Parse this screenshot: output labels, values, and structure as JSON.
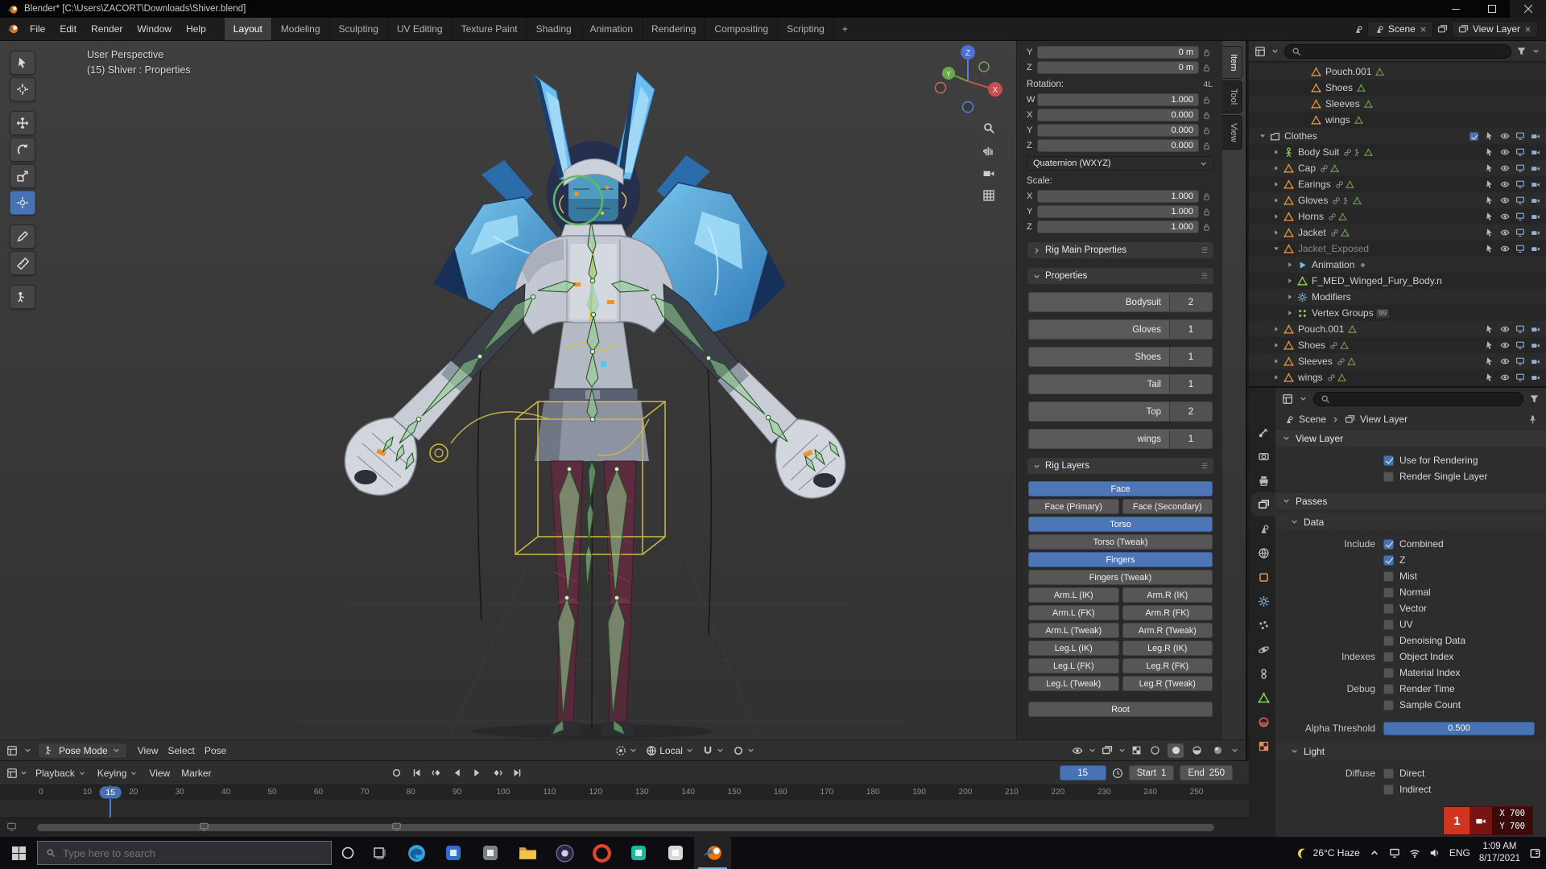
{
  "window": {
    "title": "Blender* [C:\\Users\\ZACORT\\Downloads\\Shiver.blend]"
  },
  "topbar": {
    "app_menus": [
      "File",
      "Edit",
      "Render",
      "Window",
      "Help"
    ],
    "workspaces": [
      "Layout",
      "Modeling",
      "Sculpting",
      "UV Editing",
      "Texture Paint",
      "Shading",
      "Animation",
      "Rendering",
      "Compositing",
      "Scripting"
    ],
    "active_workspace": "Layout",
    "new_workspace": "+",
    "scene": "Scene",
    "view_layer": "View Layer"
  },
  "viewport": {
    "overlay": {
      "perspective": "User Perspective",
      "context": "(15) Shiver : Properties"
    },
    "axis_labels": {
      "x": "X",
      "y": "Y",
      "z": "Z"
    },
    "tools": [
      "tweak-select",
      "cursor-3d",
      "move",
      "rotate",
      "scale",
      "transform",
      "annotate",
      "measure",
      "pose-extra"
    ],
    "active_tool_index": 5,
    "header": {
      "mode": "Pose Mode",
      "menus": [
        "View",
        "Select",
        "Pose"
      ],
      "orientation": "Local"
    },
    "sidebar_tabs": [
      {
        "label": "Item",
        "active": true
      },
      {
        "label": "Tool",
        "active": false
      },
      {
        "label": "View",
        "active": false
      }
    ]
  },
  "transform_panel": {
    "location_rows": [
      {
        "axis": "Y",
        "value": "0 m"
      },
      {
        "axis": "Z",
        "value": "0 m"
      }
    ],
    "rotation_label": "Rotation:",
    "rotation_badge": "4L",
    "rotation_rows": [
      {
        "axis": "W",
        "value": "1.000"
      },
      {
        "axis": "X",
        "value": "0.000"
      },
      {
        "axis": "Y",
        "value": "0.000"
      },
      {
        "axis": "Z",
        "value": "0.000"
      }
    ],
    "rotation_mode": "Quaternion (WXYZ)",
    "scale_label": "Scale:",
    "scale_rows": [
      {
        "axis": "X",
        "value": "1.000"
      },
      {
        "axis": "Y",
        "value": "1.000"
      },
      {
        "axis": "Z",
        "value": "1.000"
      }
    ],
    "rig_main_label": "Rig Main Properties",
    "properties_label": "Properties",
    "custom_properties": [
      {
        "label": "Bodysuit",
        "value": "2"
      },
      {
        "label": "Gloves",
        "value": "1"
      },
      {
        "label": "Shoes",
        "value": "1"
      },
      {
        "label": "Tail",
        "value": "1"
      },
      {
        "label": "Top",
        "value": "2"
      },
      {
        "label": "wings",
        "value": "1"
      }
    ],
    "rig_layers_label": "Rig Layers",
    "rig_layer_buttons": [
      {
        "label": "Face",
        "active": true,
        "full": true
      },
      {
        "label": "Face (Primary)",
        "active": false
      },
      {
        "label": "Face (Secondary)",
        "active": false
      },
      {
        "label": "Torso",
        "active": true,
        "full": true
      },
      {
        "label": "Torso (Tweak)",
        "active": false,
        "full": true
      },
      {
        "label": "Fingers",
        "active": true,
        "full": true
      },
      {
        "label": "Fingers (Tweak)",
        "active": false,
        "full": true
      },
      {
        "label": "Arm.L (IK)",
        "active": false
      },
      {
        "label": "Arm.R (IK)",
        "active": false
      },
      {
        "label": "Arm.L (FK)",
        "active": false
      },
      {
        "label": "Arm.R (FK)",
        "active": false
      },
      {
        "label": "Arm.L (Tweak)",
        "active": false
      },
      {
        "label": "Arm.R (Tweak)",
        "active": false
      },
      {
        "label": "Leg.L (IK)",
        "active": false
      },
      {
        "label": "Leg.R (IK)",
        "active": false
      },
      {
        "label": "Leg.L (FK)",
        "active": false
      },
      {
        "label": "Leg.R (FK)",
        "active": false
      },
      {
        "label": "Leg.L (Tweak)",
        "active": false
      },
      {
        "label": "Leg.R (Tweak)",
        "active": false
      },
      {
        "label": "Root",
        "active": false,
        "full": true,
        "root": true
      }
    ]
  },
  "outliner": {
    "rows": [
      {
        "label": "Pouch.001",
        "depth": 3,
        "icon": "mesh",
        "arrow": "none",
        "dim": false,
        "badges": [
          "meshdata"
        ],
        "controls": "none"
      },
      {
        "label": "Shoes",
        "depth": 3,
        "icon": "mesh",
        "arrow": "none",
        "badges": [
          "meshdata"
        ],
        "controls": "none"
      },
      {
        "label": "Sleeves",
        "depth": 3,
        "icon": "mesh",
        "arrow": "none",
        "badges": [
          "meshdata"
        ],
        "controls": "none"
      },
      {
        "label": "wings",
        "depth": 3,
        "icon": "mesh",
        "arrow": "none",
        "badges": [
          "meshdata"
        ],
        "controls": "none"
      },
      {
        "label": "Clothes",
        "depth": 0,
        "icon": "collection",
        "arrow": "open",
        "check": true,
        "controls": "full"
      },
      {
        "label": "Body Suit",
        "depth": 1,
        "icon": "armature",
        "arrow": "closed",
        "badges": [
          "link",
          "pose",
          "meshdata"
        ],
        "controls": "full"
      },
      {
        "label": "Cap",
        "depth": 1,
        "icon": "mesh",
        "arrow": "closed",
        "badges": [
          "link",
          "meshdata"
        ],
        "controls": "full"
      },
      {
        "label": "Earings",
        "depth": 1,
        "icon": "mesh",
        "arrow": "closed",
        "badges": [
          "link",
          "meshdata"
        ],
        "controls": "full"
      },
      {
        "label": "Gloves",
        "depth": 1,
        "icon": "mesh",
        "arrow": "closed",
        "badges": [
          "link",
          "pose",
          "meshdata"
        ],
        "controls": "full"
      },
      {
        "label": "Horns",
        "depth": 1,
        "icon": "mesh",
        "arrow": "closed",
        "badges": [
          "link",
          "meshdata"
        ],
        "controls": "full"
      },
      {
        "label": "Jacket",
        "depth": 1,
        "icon": "mesh",
        "arrow": "closed",
        "badges": [
          "link",
          "meshdata"
        ],
        "controls": "full"
      },
      {
        "label": "Jacket_Exposed",
        "depth": 1,
        "icon": "mesh",
        "arrow": "open",
        "dim": true,
        "controls": "full"
      },
      {
        "label": "Animation",
        "depth": 2,
        "icon": "anim",
        "arrow": "closed",
        "badges": [
          "action"
        ],
        "controls": "none"
      },
      {
        "label": "F_MED_Winged_Fury_Body.n",
        "depth": 2,
        "icon": "meshdata",
        "arrow": "closed",
        "controls": "none"
      },
      {
        "label": "Modifiers",
        "depth": 2,
        "icon": "wrench",
        "arrow": "closed",
        "controls": "none"
      },
      {
        "label": "Vertex Groups",
        "depth": 2,
        "icon": "vgroup",
        "arrow": "closed",
        "count": "99",
        "controls": "none"
      },
      {
        "label": "Pouch.001",
        "depth": 1,
        "icon": "mesh",
        "arrow": "closed",
        "badges": [
          "meshdata"
        ],
        "controls": "full"
      },
      {
        "label": "Shoes",
        "depth": 1,
        "icon": "mesh",
        "arrow": "closed",
        "badges": [
          "link",
          "meshdata"
        ],
        "controls": "full"
      },
      {
        "label": "Sleeves",
        "depth": 1,
        "icon": "mesh",
        "arrow": "closed",
        "badges": [
          "link",
          "meshdata"
        ],
        "controls": "full"
      },
      {
        "label": "wings",
        "depth": 1,
        "icon": "mesh",
        "arrow": "closed",
        "badges": [
          "link",
          "meshdata"
        ],
        "controls": "full"
      }
    ]
  },
  "properties_editor": {
    "tabs": [
      {
        "name": "tool",
        "icon": "tooltab",
        "color": "#b8b8b8",
        "active": false
      },
      {
        "name": "render",
        "icon": "renderic",
        "color": "#b8b8b8",
        "active": false
      },
      {
        "name": "output",
        "icon": "printer",
        "color": "#b8b8b8",
        "active": false
      },
      {
        "name": "view-layer",
        "icon": "images",
        "color": "#e0e0e0",
        "active": true
      },
      {
        "name": "scene",
        "icon": "scene",
        "color": "#b8b8b8",
        "active": false
      },
      {
        "name": "world",
        "icon": "globe",
        "color": "#b8b8b8",
        "active": false
      },
      {
        "name": "object",
        "icon": "square",
        "color": "#e0903f",
        "active": false
      },
      {
        "name": "modifiers",
        "icon": "wrench",
        "color": "#7aa8e0",
        "active": false
      },
      {
        "name": "particles",
        "icon": "particles",
        "color": "#b8b8b8",
        "active": false
      },
      {
        "name": "physics",
        "icon": "physics",
        "color": "#b8b8b8",
        "active": false
      },
      {
        "name": "constraints",
        "icon": "constraint",
        "color": "#b8b8b8",
        "active": false
      },
      {
        "name": "object-data",
        "icon": "mesh",
        "color": "#8fce5a",
        "active": false
      },
      {
        "name": "material",
        "icon": "matsphere",
        "color": "#e06868",
        "active": false
      },
      {
        "name": "texture",
        "icon": "checker",
        "color": "#d88f6f",
        "active": false
      }
    ],
    "breadcrumb": {
      "scene": "Scene",
      "view_layer": "View Layer"
    },
    "view_layer_section": {
      "title": "View Layer",
      "checks": [
        {
          "label": "Use for Rendering",
          "checked": true
        },
        {
          "label": "Render Single Layer",
          "checked": false
        }
      ]
    },
    "passes_section": {
      "title": "Passes",
      "data_subsection": {
        "title": "Data",
        "groups": [
          {
            "label": "Include",
            "checks": [
              {
                "label": "Combined",
                "checked": true
              },
              {
                "label": "Z",
                "checked": true
              },
              {
                "label": "Mist",
                "checked": false
              },
              {
                "label": "Normal",
                "checked": false
              },
              {
                "label": "Vector",
                "checked": false
              },
              {
                "label": "UV",
                "checked": false
              },
              {
                "label": "Denoising Data",
                "checked": false
              }
            ]
          },
          {
            "label": "Indexes",
            "checks": [
              {
                "label": "Object Index",
                "checked": false
              },
              {
                "label": "Material Index",
                "checked": false
              }
            ]
          },
          {
            "label": "Debug",
            "checks": [
              {
                "label": "Render Time",
                "checked": false
              },
              {
                "label": "Sample Count",
                "checked": false
              }
            ]
          }
        ],
        "alpha_threshold": {
          "label": "Alpha Threshold",
          "value": "0.500"
        }
      },
      "light_subsection": {
        "title": "Light",
        "groups": [
          {
            "label": "Diffuse",
            "checks": [
              {
                "label": "Direct",
                "checked": false
              },
              {
                "label": "Indirect",
                "checked": false
              }
            ]
          }
        ]
      }
    }
  },
  "timeline": {
    "menus": [
      "Playback",
      "Keying",
      "View",
      "Marker"
    ],
    "current_frame": "15",
    "start_label": "Start",
    "start_value": "1",
    "end_label": "End",
    "end_value": "250",
    "ticks": [
      0,
      10,
      20,
      30,
      40,
      50,
      60,
      70,
      80,
      90,
      100,
      110,
      120,
      130,
      140,
      150,
      160,
      170,
      180,
      190,
      200,
      210,
      220,
      230,
      240,
      250
    ],
    "playhead_frame": 15
  },
  "recorder_overlay": {
    "badge": "1",
    "x_label": "X 700",
    "y_label": "Y 700"
  },
  "taskbar": {
    "search_placeholder": "Type here to search",
    "apps": [
      {
        "name": "edge",
        "color": "#35a3dd",
        "active": false
      },
      {
        "name": "app-blue",
        "color": "#2f6fd0",
        "active": false
      },
      {
        "name": "app-gray",
        "color": "#7b8187",
        "active": false
      },
      {
        "name": "file-explorer",
        "color": "#f3c24a",
        "active": false
      },
      {
        "name": "obs",
        "color": "#2b2640",
        "active": false
      },
      {
        "name": "opera",
        "color": "#e0452f",
        "active": false
      },
      {
        "name": "app-teal",
        "color": "#1db8a0",
        "active": false
      },
      {
        "name": "app-light",
        "color": "#d8d8d8",
        "active": false
      },
      {
        "name": "blender",
        "color": "#ea7600",
        "active": true
      }
    ],
    "tray": {
      "weather": "26°C Haze",
      "lang": "ENG",
      "time": "1:09 AM",
      "date": "8/17/2021"
    }
  }
}
